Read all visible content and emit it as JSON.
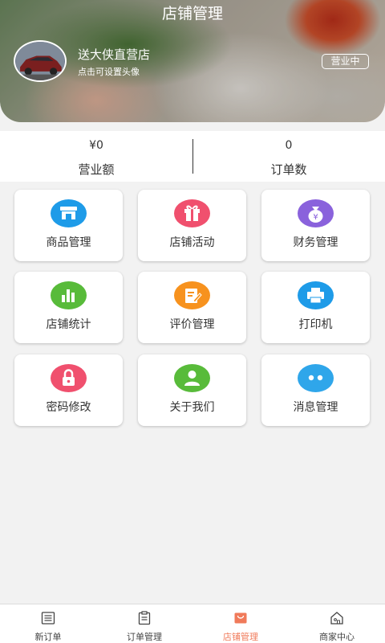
{
  "header": {
    "title": "店铺管理",
    "store_name": "送大侠直营店",
    "avatar_hint": "点击可设置头像",
    "status": "营业中"
  },
  "stats": {
    "revenue_value": "¥0",
    "revenue_label": "营业额",
    "orders_value": "0",
    "orders_label": "订单数"
  },
  "menu": [
    {
      "label": "商品管理",
      "icon": "store-icon",
      "color": "#1e9be8"
    },
    {
      "label": "店铺活动",
      "icon": "gift-icon",
      "color": "#f0506e"
    },
    {
      "label": "财务管理",
      "icon": "money-bag-icon",
      "color": "#8a62dc"
    },
    {
      "label": "店铺统计",
      "icon": "bar-chart-icon",
      "color": "#58bb3a"
    },
    {
      "label": "评价管理",
      "icon": "edit-icon",
      "color": "#f7921e"
    },
    {
      "label": "打印机",
      "icon": "printer-icon",
      "color": "#1e9be8"
    },
    {
      "label": "密码修改",
      "icon": "lock-icon",
      "color": "#f0506e"
    },
    {
      "label": "关于我们",
      "icon": "user-icon",
      "color": "#58bb3a"
    },
    {
      "label": "消息管理",
      "icon": "chat-icon",
      "color": "#2fa6ea"
    }
  ],
  "bottom_nav": [
    {
      "label": "新订单",
      "icon": "list-icon",
      "active": false
    },
    {
      "label": "订单管理",
      "icon": "clipboard-icon",
      "active": false
    },
    {
      "label": "店铺管理",
      "icon": "bag-icon",
      "active": true
    },
    {
      "label": "商家中心",
      "icon": "home-icon",
      "active": false
    }
  ],
  "colors": {
    "accent": "#f07a5a",
    "background": "#f2f2f2"
  }
}
